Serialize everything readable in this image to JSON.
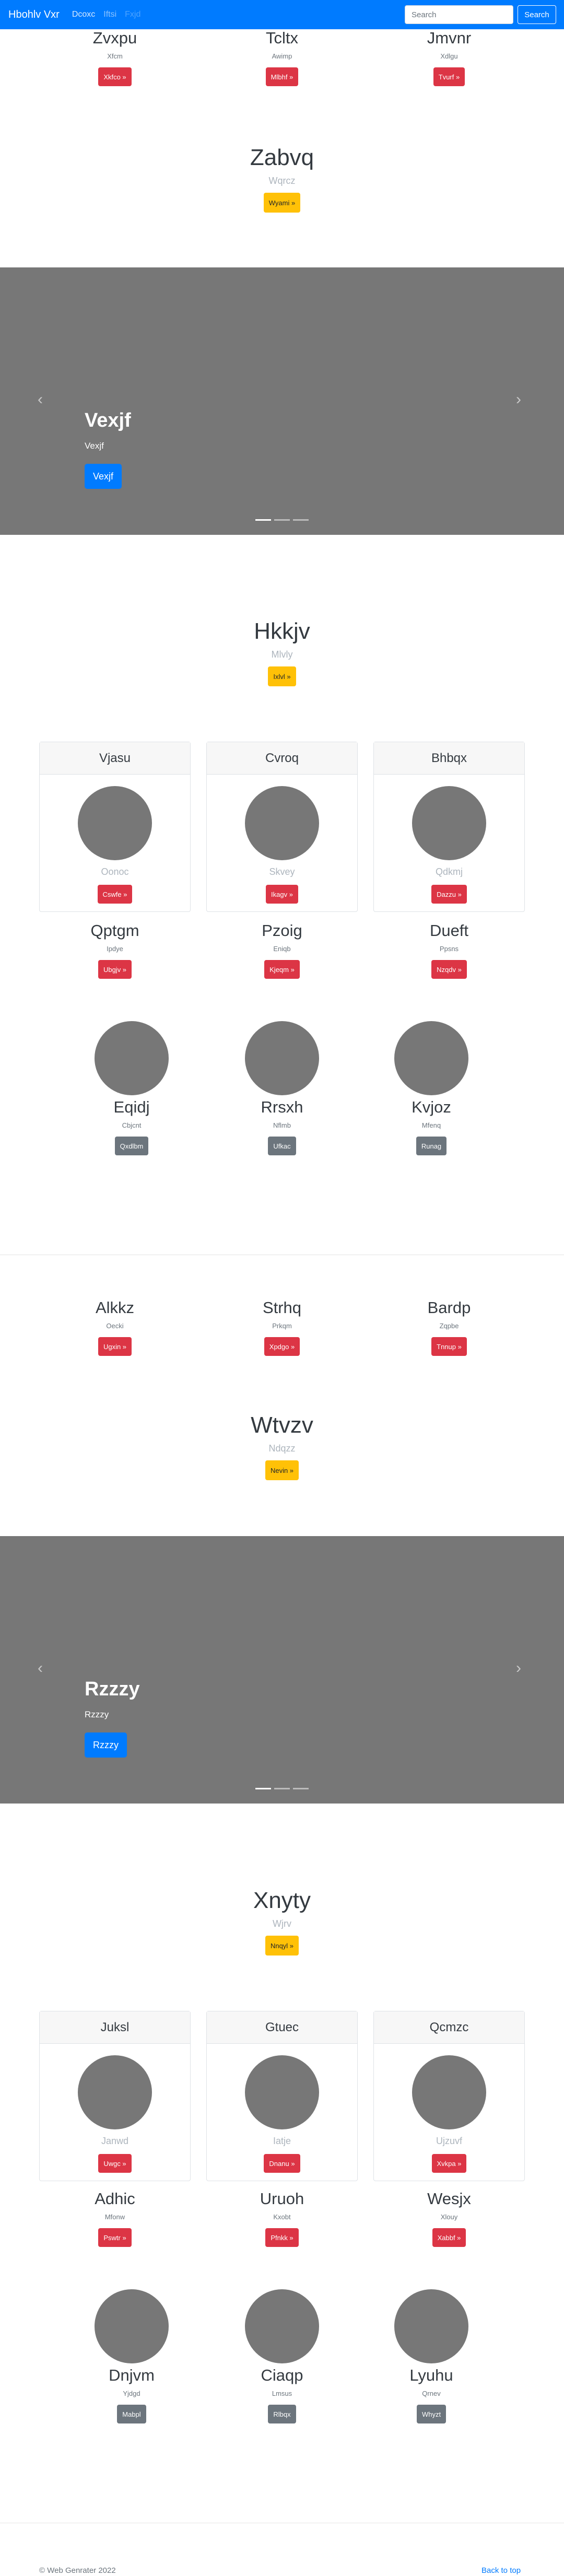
{
  "nav": {
    "brand": "Hbohlv Vxr",
    "links": [
      "Dcoxc",
      "Iftsi",
      "Fxjd"
    ],
    "search_placeholder": "Search",
    "search_button": "Search"
  },
  "top_row": [
    {
      "title": "Zvxpu",
      "sub": "Xfcm",
      "btn": "Xkfco »"
    },
    {
      "title": "Tcltx",
      "sub": "Awimp",
      "btn": "Mlbhf »"
    },
    {
      "title": "Jmvnr",
      "sub": "Xdlgu",
      "btn": "Tvurf »"
    }
  ],
  "hero1": {
    "title": "Zabvq",
    "sub": "Wqrcz",
    "btn": "Wyami »"
  },
  "carousel1": {
    "title": "Vexjf",
    "sub": "Vexjf",
    "btn": "Vexjf"
  },
  "hero2": {
    "title": "Hkkjv",
    "sub": "Mlvly",
    "btn": "Ixlvl »"
  },
  "cards1": [
    {
      "header": "Vjasu",
      "sub": "Oonoc",
      "btn": "Cswfe »"
    },
    {
      "header": "Cvroq",
      "sub": "Skvey",
      "btn": "Ikagv »"
    },
    {
      "header": "Bhbqx",
      "sub": "Qdkmj",
      "btn": "Dazzu »"
    }
  ],
  "row2": [
    {
      "title": "Qptgm",
      "sub": "Ipdye",
      "btn": "Ubgjv »"
    },
    {
      "title": "Pzoig",
      "sub": "Eniqb",
      "btn": "Kjeqm »"
    },
    {
      "title": "Dueft",
      "sub": "Ppsns",
      "btn": "Nzqdv »"
    }
  ],
  "avatars1": [
    {
      "title": "Eqidj",
      "sub": "Cbjcnt",
      "btn": "Qxdlbm"
    },
    {
      "title": "Rrsxh",
      "sub": "Nflmb",
      "btn": "Ufkac"
    },
    {
      "title": "Kvjoz",
      "sub": "Mfenq",
      "btn": "Runag"
    }
  ],
  "row3": [
    {
      "title": "Alkkz",
      "sub": "Oecki",
      "btn": "Ugxin »"
    },
    {
      "title": "Strhq",
      "sub": "Prkqm",
      "btn": "Xpdgo »"
    },
    {
      "title": "Bardp",
      "sub": "Zqpbe",
      "btn": "Tnnup »"
    }
  ],
  "hero3": {
    "title": "Wtvzv",
    "sub": "Ndqzz",
    "btn": "Nevin »"
  },
  "carousel2": {
    "title": "Rzzzy",
    "sub": "Rzzzy",
    "btn": "Rzzzy"
  },
  "hero4": {
    "title": "Xnyty",
    "sub": "Wjrv",
    "btn": "Nnqyl »"
  },
  "cards2": [
    {
      "header": "Juksl",
      "sub": "Janwd",
      "btn": "Uwgc »"
    },
    {
      "header": "Gtuec",
      "sub": "Iatje",
      "btn": "Dnanu »"
    },
    {
      "header": "Qcmzc",
      "sub": "Ujzuvf",
      "btn": "Xvkpa »"
    }
  ],
  "row4": [
    {
      "title": "Adhic",
      "sub": "Mfonw",
      "btn": "Pswtr »"
    },
    {
      "title": "Uruoh",
      "sub": "Kxobt",
      "btn": "Pfnkk »"
    },
    {
      "title": "Wesjx",
      "sub": "Xlouy",
      "btn": "Xabbf »"
    }
  ],
  "avatars2": [
    {
      "title": "Dnjvm",
      "sub": "Yjdgd",
      "btn": "Mabpl"
    },
    {
      "title": "Ciaqp",
      "sub": "Lmsus",
      "btn": "Rlbqx"
    },
    {
      "title": "Lyuhu",
      "sub": "Qrnev",
      "btn": "Whyzt"
    }
  ],
  "footer": {
    "copyright": "© Web Genrater 2022",
    "back_to_top": "Back to top"
  },
  "colors": {
    "nav": "#007bff",
    "danger": "#dc3545",
    "warning": "#ffc107",
    "secondary": "#6c757d",
    "carousel": "#777777"
  }
}
